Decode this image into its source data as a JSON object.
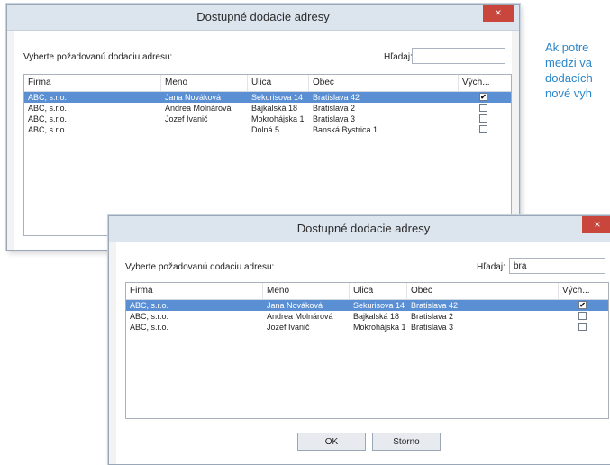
{
  "side_text": [
    "Ak potre",
    "medzi vä",
    "dodacích",
    "nové vyh"
  ],
  "window1": {
    "title": "Dostupné dodacie adresy",
    "close": "×",
    "prompt": "Vyberte požadovanú dodaciu adresu:",
    "search_label": "Hľadaj:",
    "search_value": "",
    "columns": [
      "Firma",
      "Meno",
      "Ulica",
      "Obec",
      "Vých..."
    ],
    "rows": [
      {
        "firma": "ABC, s.r.o.",
        "meno": "Jana Nováková",
        "ulica": "Sekurisova 14",
        "obec": "Bratislava 42",
        "checked": true,
        "selected": true
      },
      {
        "firma": "ABC, s.r.o.",
        "meno": "Andrea Molnárová",
        "ulica": "Bajkalská 18",
        "obec": "Bratislava 2",
        "checked": false,
        "selected": false
      },
      {
        "firma": "ABC, s.r.o.",
        "meno": "Jozef Ivanič",
        "ulica": "Mokrohájska 1",
        "obec": "Bratislava 3",
        "checked": false,
        "selected": false
      },
      {
        "firma": "ABC, s.r.o.",
        "meno": "",
        "ulica": "Dolná 5",
        "obec": "Banská Bystrica 1",
        "checked": false,
        "selected": false
      }
    ]
  },
  "window2": {
    "title": "Dostupné dodacie adresy",
    "close": "×",
    "prompt": "Vyberte požadovanú dodaciu adresu:",
    "search_label": "Hľadaj:",
    "search_value": "bra",
    "columns": [
      "Firma",
      "Meno",
      "Ulica",
      "Obec",
      "Vých..."
    ],
    "rows": [
      {
        "firma": "ABC, s.r.o.",
        "meno": "Jana Nováková",
        "ulica": "Sekurisova 14",
        "obec": "Bratislava 42",
        "checked": true,
        "selected": true
      },
      {
        "firma": "ABC, s.r.o.",
        "meno": "Andrea Molnárová",
        "ulica": "Bajkalská 18",
        "obec": "Bratislava 2",
        "checked": false,
        "selected": false
      },
      {
        "firma": "ABC, s.r.o.",
        "meno": "Jozef Ivanič",
        "ulica": "Mokrohájska 1",
        "obec": "Bratislava 3",
        "checked": false,
        "selected": false
      }
    ],
    "ok_label": "OK",
    "cancel_label": "Storno"
  },
  "colors": {
    "selection": "#5b8fd4",
    "close": "#c9463d",
    "titlebar": "#dce4ee",
    "side_text": "#2a86c9"
  }
}
